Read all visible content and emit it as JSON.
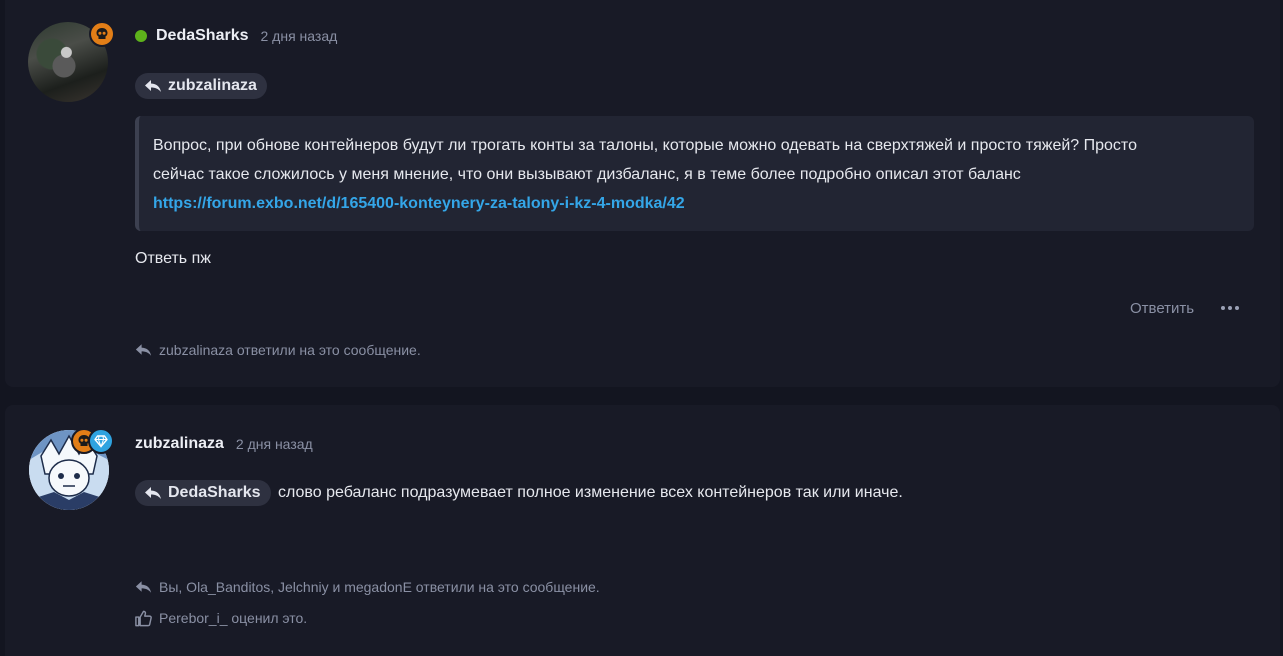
{
  "posts": [
    {
      "username": "DedaSharks",
      "time": "2 дня назад",
      "mention": "zubzalinaza",
      "quote_line1": "Вопрос, при обнове контейнеров будут ли трогать конты за талоны, которые можно одевать на сверхтяжей и просто тяжей? Просто",
      "quote_line2": "сейчас такое сложилось у меня мнение, что они вызывают дизбаланс, я в теме более подробно описал этот баланс",
      "quote_link": "https://forum.exbo.net/d/165400-konteynery-za-talony-i-kz-4-modka/42",
      "body": "Ответь пж",
      "reply_label": "Ответить",
      "replied_by": "zubzalinaza ответили на это сообщение."
    },
    {
      "username": "zubzalinaza",
      "time": "2 дня назад",
      "mention": "DedaSharks",
      "body": "слово ребаланс подразумевает полное изменение всех контейнеров так или иначе.",
      "replied_by": "Вы, Ola_Banditos, Jelchniy и megadonE ответили на это сообщение.",
      "liked_by": "Perebor_i_ оценил это."
    }
  ],
  "colors": {
    "online": "#5db21b",
    "badge_orange": "#e27e17",
    "badge_blue": "#2fa3e0",
    "link": "#34a6e8"
  },
  "icons": {
    "badge_1": "skull-icon",
    "badge_2a": "skull-icon",
    "badge_2b": "diamond-icon",
    "reply_arrow": "reply-icon",
    "like": "thumbs-up-icon",
    "more": "ellipsis-icon"
  }
}
